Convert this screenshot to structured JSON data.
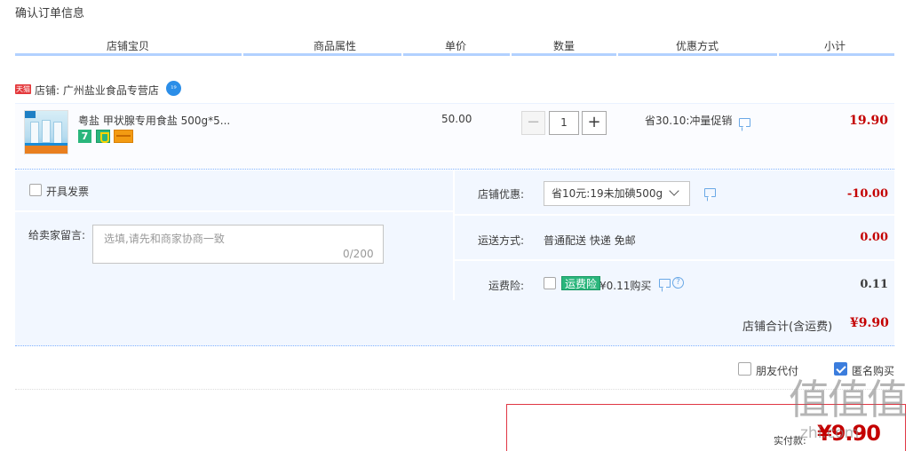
{
  "page_title": "确认订单信息",
  "columns": [
    "店铺宝贝",
    "商品属性",
    "单价",
    "数量",
    "优惠方式",
    "小计"
  ],
  "shop": {
    "logo_text": "天猫",
    "name": "店铺: 广州盐业食品专营店",
    "wangwang_icon": "wangwang-chat-icon"
  },
  "item": {
    "title": "粤盐 甲状腺专用食盐 500g*5...",
    "badges": [
      "7-day-return-icon",
      "shield-guarantee-icon",
      "credit-card-icon"
    ],
    "badge_7": "7",
    "unit_price": "50.00",
    "quantity": "1",
    "minus_label": "−",
    "plus_label": "+",
    "promo": "省30.10:冲量促销",
    "subtotal": "19.90"
  },
  "invoice": {
    "label": "开具发票",
    "checked": false
  },
  "message": {
    "label": "给卖家留言:",
    "placeholder": "选填,请先和商家协商一致",
    "count": "0/200"
  },
  "shop_coupon": {
    "label": "店铺优惠:",
    "selected": "省10元:19未加碘500g",
    "amount": "-10.00"
  },
  "shipping": {
    "label": "运送方式:",
    "method": "普通配送 快递 免邮",
    "amount": "0.00"
  },
  "insurance": {
    "label": "运费险:",
    "tag": "运费险",
    "price_text": "¥0.11购买",
    "amount": "0.11"
  },
  "shop_total": {
    "label": "店铺合计(含运费)",
    "value": "¥9.90"
  },
  "options": {
    "friend_pay": "朋友代付",
    "anonymous": "匿名购买",
    "anonymous_checked": true
  },
  "payment": {
    "label": "实付款:",
    "value": "¥9.90"
  },
  "watermark": {
    "main": "值值值",
    "url": "zhi.com"
  },
  "colors": {
    "accent_red": "#c40000",
    "header_line": "#b2d1ff",
    "row_bg": "#f2f7ff",
    "green_tag": "#2ab67c",
    "checkbox_blue": "#3b7ddd"
  }
}
